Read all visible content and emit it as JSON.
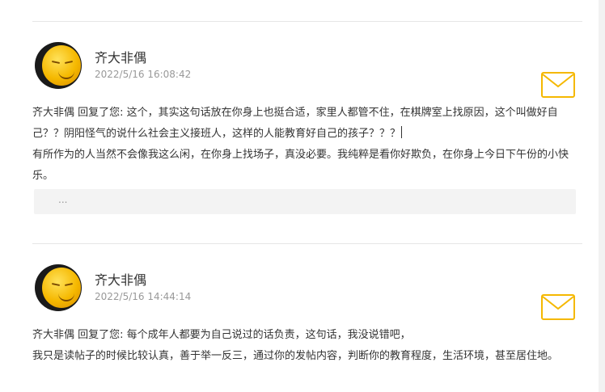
{
  "posts": [
    {
      "author": "齐大非偶",
      "time": "2022/5/16 16:08:42",
      "reply_prefix": "齐大非偶 回复了您: ",
      "quoted": "这个，其实这句话放在你身上也挺合适，家里人都管不住，在棋牌室上找原因，这个叫做好自己？？阴阳怪气的说什么社会主义接班人，这样的人能教育好自己的孩子？？？",
      "reply": "有所作为的人当然不会像我这么闲，在你身上找场子，真没必要。我纯粹是看你好欺负，在你身上今日下午份的小快乐。",
      "quote_box": "..."
    },
    {
      "author": "齐大非偶",
      "time": "2022/5/16 14:44:14",
      "reply_prefix": "齐大非偶 回复了您: ",
      "quoted": "每个成年人都要为自己说过的话负责，这句话，我没说错吧，",
      "reply": "我只是读帖子的时候比较认真，善于举一反三，通过你的发帖内容，判断你的教育程度，生活环境，甚至居住地。"
    }
  ],
  "icons": {
    "mail": "mail-icon",
    "mail_color": "#f5b800"
  }
}
